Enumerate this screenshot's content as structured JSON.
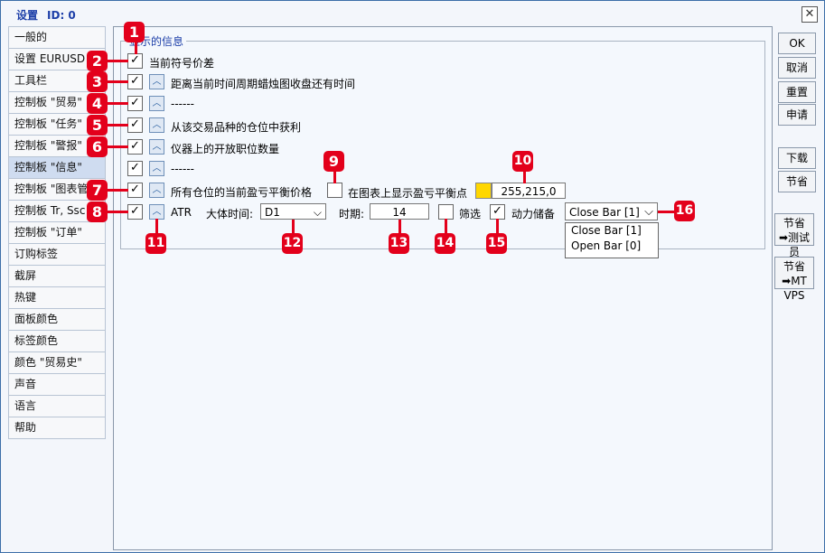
{
  "window": {
    "title": "设置",
    "id_label": "ID: 0"
  },
  "sidebar": {
    "items": [
      {
        "label": "一般的"
      },
      {
        "label": "设置 EURUSD"
      },
      {
        "label": "工具栏"
      },
      {
        "label": "控制板 \"贸易\""
      },
      {
        "label": "控制板 \"任务\""
      },
      {
        "label": "控制板 \"警报\""
      },
      {
        "label": "控制板 \"信息\"",
        "active": true
      },
      {
        "label": "控制板 \"图表管理\""
      },
      {
        "label": "控制板 Tr, Ssc"
      },
      {
        "label": "控制板 \"订单\""
      },
      {
        "label": "订购标签"
      },
      {
        "label": "截屏"
      },
      {
        "label": "热键"
      },
      {
        "label": "面板颜色"
      },
      {
        "label": "标签颜色"
      },
      {
        "label": "颜色 \"贸易史\""
      },
      {
        "label": "声音"
      },
      {
        "label": "语言"
      },
      {
        "label": "帮助"
      }
    ]
  },
  "group": {
    "label": "显示的信息",
    "rows": [
      {
        "label": "当前符号价差",
        "checked": true
      },
      {
        "label": "距离当前时间周期蜡烛图收盘还有时间",
        "checked": true
      },
      {
        "label": "------",
        "checked": true
      },
      {
        "label": "从该交易品种的仓位中获利",
        "checked": true
      },
      {
        "label": "仪器上的开放职位数量",
        "checked": true
      },
      {
        "label": "------",
        "checked": true
      },
      {
        "label": "所有仓位的当前盈亏平衡价格",
        "checked": true
      },
      {
        "label": "ATR",
        "checked": true
      }
    ],
    "breakeven_chart_label": "在图表上显示盈亏平衡点",
    "breakeven_color_value": "255,215,0",
    "breakeven_color": "#ffd700",
    "atr": {
      "timeframe_label": "大体时间:",
      "timeframe_value": "D1",
      "period_label": "时期:",
      "period_value": "14",
      "filter_label": "筛选",
      "dynamic_label": "动力储备",
      "bar_value": "Close Bar [1]",
      "bar_options": [
        "Close Bar [1]",
        "Open Bar [0]"
      ]
    }
  },
  "buttons": {
    "ok": "OK",
    "cancel": "取消",
    "reset": "重置",
    "apply": "申请",
    "download": "下载",
    "save": "节省",
    "save_tester_line1": "节省",
    "save_tester_line2": "测试员",
    "save_mtvps_line1": "节省",
    "save_mtvps_line2": "MT VPS"
  },
  "badges": [
    "1",
    "2",
    "3",
    "4",
    "5",
    "6",
    "7",
    "8",
    "9",
    "10",
    "11",
    "12",
    "13",
    "14",
    "15",
    "16"
  ],
  "colors": {
    "badge": "#e3001b",
    "title": "#1c3ea8",
    "active_tab": "#cfdcf0"
  }
}
